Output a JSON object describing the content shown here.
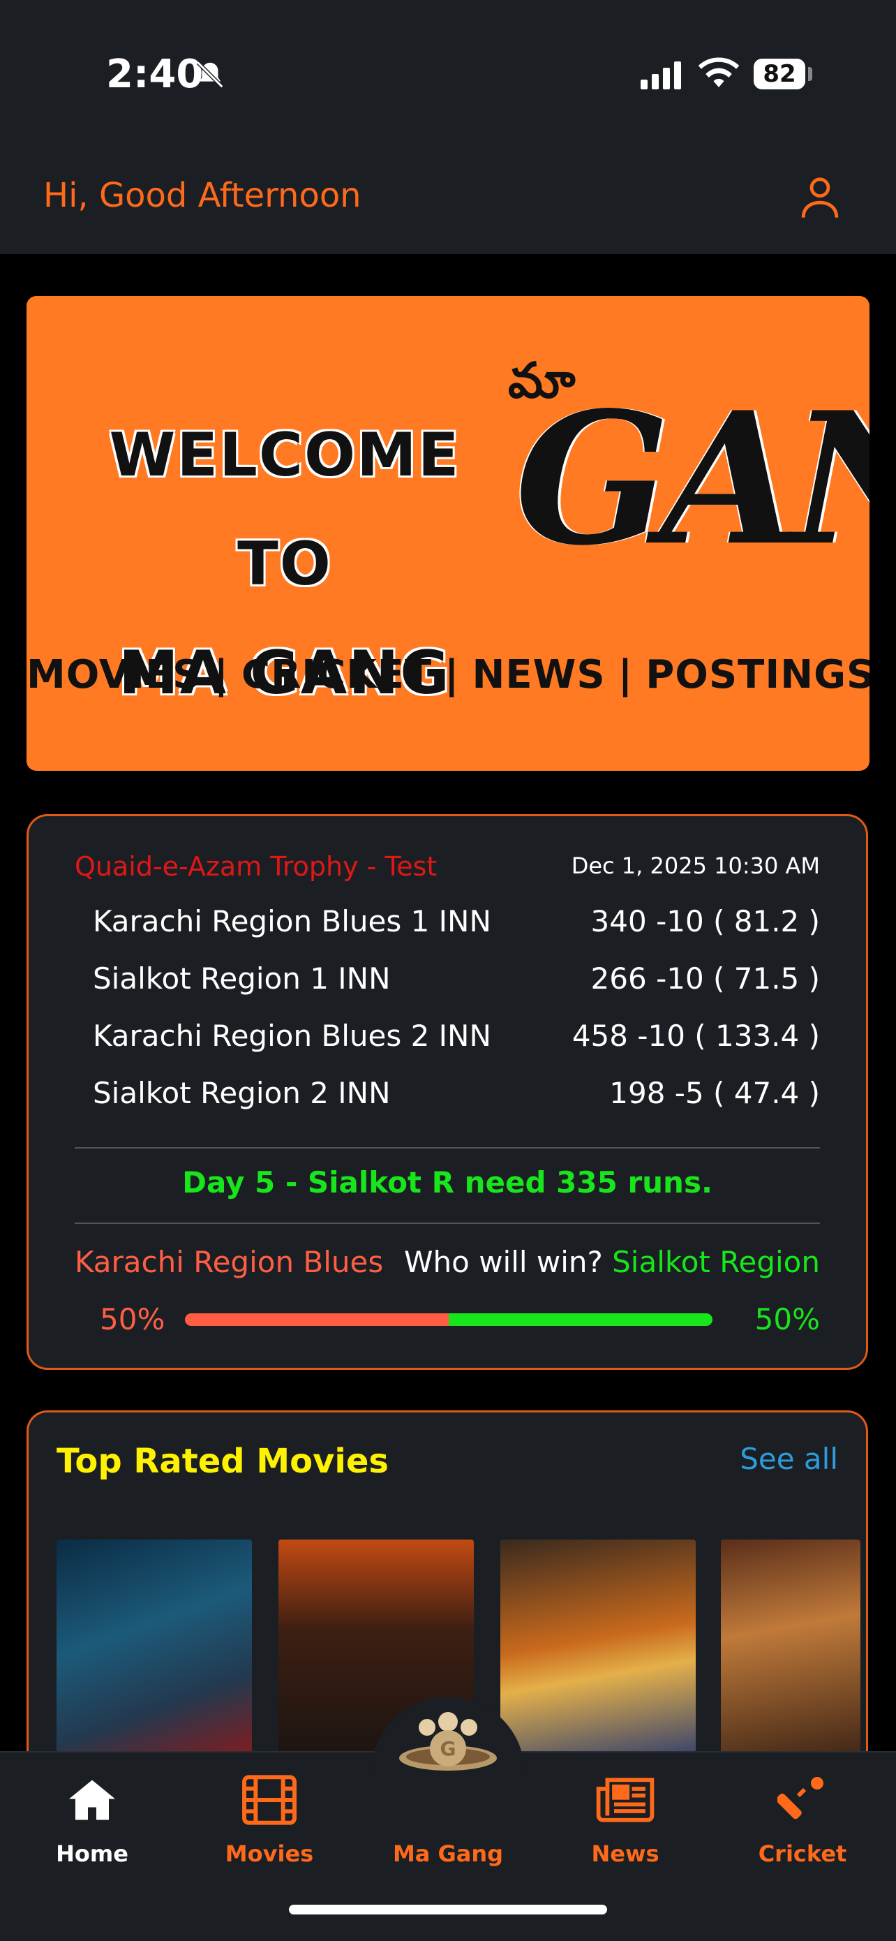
{
  "status_bar": {
    "time": "2:40",
    "battery": "82"
  },
  "header": {
    "greeting": "Hi, Good Afternoon"
  },
  "banner": {
    "welcome_line1": "WELCOME TO",
    "welcome_line2": "MA GANG",
    "logo_script": "మా",
    "logo_word": "GANG",
    "categories": [
      "MOVIES",
      "CRICKET",
      "NEWS",
      "POSTINGS"
    ]
  },
  "match": {
    "tournament": "Quaid-e-Azam Trophy - Test",
    "datetime": "Dec 1, 2025 10:30 AM",
    "innings": [
      {
        "team": "Karachi Region Blues 1 INN",
        "score": "340 -10 ( 81.2 )"
      },
      {
        "team": "Sialkot Region 1 INN",
        "score": "266 -10 ( 71.5 )"
      },
      {
        "team": "Karachi Region Blues 2 INN",
        "score": "458 -10 ( 133.4 )"
      },
      {
        "team": "Sialkot Region 2 INN",
        "score": "198 -5 ( 47.4 )"
      }
    ],
    "status": "Day 5 - Sialkot R need 335 runs.",
    "poll": {
      "team_a": "Karachi Region Blues",
      "question": "Who will win?",
      "team_b": "Sialkot Region",
      "pct_a": "50%",
      "pct_b": "50%",
      "share_a": 0.5
    }
  },
  "movies": {
    "title": "Top Rated Movies",
    "see_all": "See all"
  },
  "tabs": {
    "home": "Home",
    "movies": "Movies",
    "magang": "Ma Gang",
    "news": "News",
    "cricket": "Cricket"
  },
  "colors": {
    "accent": "#ff6a1a",
    "banner": "#ff7a22",
    "win": "#18e51c",
    "lose": "#ff5e45",
    "movies_title": "#fff200",
    "link": "#2d9cdb"
  }
}
